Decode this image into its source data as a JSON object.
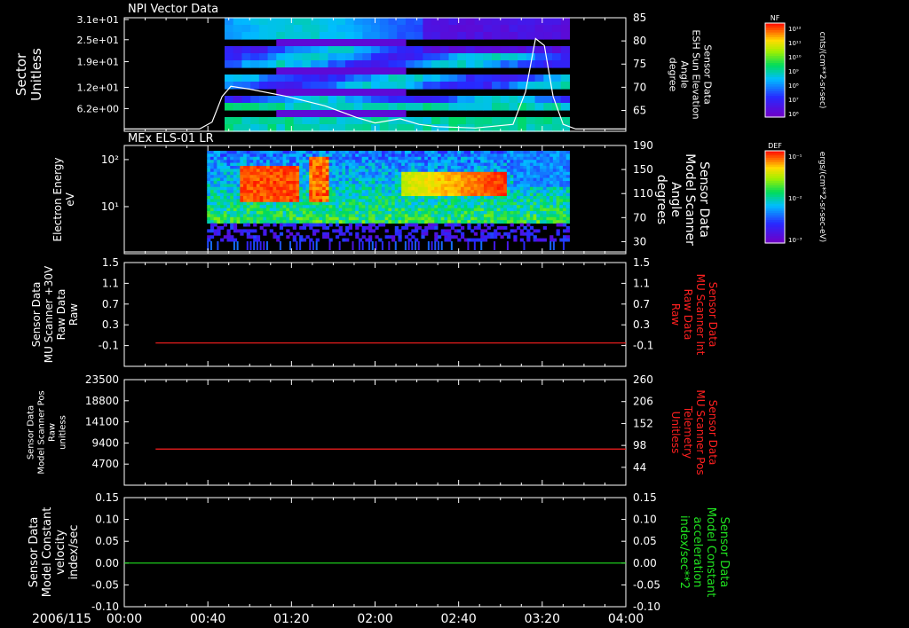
{
  "time_axis": {
    "date_label": "2006/115",
    "tick_labels": [
      "00:00",
      "00:40",
      "01:20",
      "02:00",
      "02:40",
      "03:20",
      "04:00"
    ],
    "range_hours": [
      0,
      4
    ]
  },
  "colors": {
    "background": "#000000",
    "axis": "#ffffff",
    "red_trace": "#ff2020",
    "green_trace": "#20e020",
    "white_trace": "#ffffff"
  },
  "colorbars": [
    {
      "title": "NF",
      "unit_label": "cnts/(cm**2-sr-sec)",
      "tick_labels": [
        "10¹²",
        "10¹¹",
        "10¹⁰",
        "10⁹",
        "10⁸",
        "10⁷",
        "10⁶"
      ]
    },
    {
      "title": "DEF",
      "unit_label": "ergs/(cm**2-sr-sec-eV)",
      "tick_labels": [
        "10⁻¹",
        "10⁻²",
        "10⁻³"
      ]
    }
  ],
  "chart_data": [
    {
      "type": "heatmap",
      "title": "NPI Vector Data",
      "ylabel": [
        "Sector",
        "Unitless"
      ],
      "y_tick_labels": [
        "3.1e+01",
        "2.5e+01",
        "1.9e+01",
        "1.2e+01",
        "6.2e+00"
      ],
      "y_ticks": [
        31,
        25,
        19,
        12,
        6.2
      ],
      "ylim": [
        0,
        31
      ],
      "data_extent_hours": [
        0.8,
        3.55
      ],
      "overlay_series": {
        "name": "ESH Sun Elevation Angle",
        "right_label": [
          "Sensor Data",
          "ESH Sun Elevation",
          "Angle",
          "degree"
        ],
        "right_tick_labels": [
          "85",
          "80",
          "75",
          "70",
          "65"
        ],
        "right_ticks": [
          85,
          80,
          75,
          70,
          65
        ],
        "right_lim": [
          60.5,
          85
        ],
        "x": [
          0.0,
          0.6,
          0.7,
          0.78,
          0.85,
          1.0,
          1.3,
          1.6,
          1.85,
          2.0,
          2.2,
          2.35,
          2.5,
          2.8,
          3.1,
          3.2,
          3.28,
          3.35,
          3.42,
          3.5,
          3.6,
          4.0
        ],
        "values": [
          61,
          61,
          62.5,
          68,
          70.2,
          69.6,
          68,
          66,
          63.5,
          62.3,
          63.2,
          62,
          61.5,
          61.2,
          62,
          69,
          80.5,
          79,
          68,
          62,
          61,
          61
        ]
      }
    },
    {
      "type": "heatmap",
      "title": "MEx ELS-01 LR",
      "ylabel": [
        "Electron Energy",
        "eV"
      ],
      "y_tick_labels": [
        "10²",
        "10¹"
      ],
      "ylim_log": [
        0,
        2.3
      ],
      "data_extent_hours": [
        0.66,
        3.55
      ],
      "right_label": [
        "Sensor Data",
        "Model Scanner",
        "Angle",
        "degrees"
      ],
      "right_tick_labels": [
        "190",
        "150",
        "110",
        "70",
        "30"
      ],
      "right_ticks": [
        190,
        150,
        110,
        70,
        30
      ],
      "right_lim": [
        10,
        190
      ],
      "overlay_series": {
        "name": "Model Scanner Angle",
        "x": [
          0.0,
          4.0
        ],
        "values": [
          13,
          13
        ]
      }
    },
    {
      "type": "line",
      "ylabel": [
        "Sensor Data",
        "MU Scanner +30V",
        "Raw Data",
        "Raw"
      ],
      "y_tick_labels": [
        "1.5",
        "1.1",
        "0.7",
        "0.3",
        "-0.1"
      ],
      "y_ticks": [
        1.5,
        1.1,
        0.7,
        0.3,
        -0.1
      ],
      "ylim": [
        -0.5,
        1.5
      ],
      "right_label": [
        "Sensor Data",
        "MU Scanner Int",
        "Raw Data",
        "Raw"
      ],
      "right_tick_labels": [
        "1.5",
        "1.1",
        "0.7",
        "0.3",
        "-0.1"
      ],
      "right_ticks": [
        1.5,
        1.1,
        0.7,
        0.3,
        -0.1
      ],
      "series": [
        {
          "color": "red_trace",
          "x": [
            0.25,
            4.0
          ],
          "values": [
            -0.05,
            -0.05
          ]
        }
      ]
    },
    {
      "type": "line",
      "ylabel": [
        "Sensor Data",
        "Model Scanner Pos",
        "Raw",
        "unitless"
      ],
      "y_tick_labels": [
        "23500",
        "18800",
        "14100",
        "9400",
        "4700"
      ],
      "y_ticks": [
        23500,
        18800,
        14100,
        9400,
        4700
      ],
      "ylim": [
        0,
        23500
      ],
      "right_label": [
        "Sensor Data",
        "MU Scanner Pos",
        "Telemetry",
        "Unitless"
      ],
      "right_tick_labels": [
        "260",
        "206",
        "152",
        "98",
        "44"
      ],
      "right_ticks": [
        260,
        206,
        152,
        98,
        44
      ],
      "right_lim": [
        0,
        260
      ],
      "series": [
        {
          "color": "red_trace",
          "axis": "right",
          "x": [
            0.25,
            4.0
          ],
          "values": [
            89,
            89
          ]
        }
      ]
    },
    {
      "type": "line",
      "ylabel": [
        "Sensor Data",
        "Model Constant",
        "velocity",
        "index/sec"
      ],
      "y_tick_labels": [
        "0.15",
        "0.10",
        "0.05",
        "0.00",
        "-0.05",
        "-0.10"
      ],
      "y_ticks": [
        0.15,
        0.1,
        0.05,
        0.0,
        -0.05,
        -0.1
      ],
      "ylim": [
        -0.1,
        0.15
      ],
      "right_label": [
        "Sensor Data",
        "Model Constant",
        "acceleration",
        "index/sec**2"
      ],
      "right_tick_labels": [
        "0.15",
        "0.10",
        "0.05",
        "0.00",
        "-0.05",
        "-0.10"
      ],
      "right_ticks": [
        0.15,
        0.1,
        0.05,
        0.0,
        -0.05,
        -0.1
      ],
      "series": [
        {
          "color": "green_trace",
          "x": [
            0.0,
            4.0
          ],
          "values": [
            0.0,
            0.0
          ]
        }
      ]
    }
  ]
}
